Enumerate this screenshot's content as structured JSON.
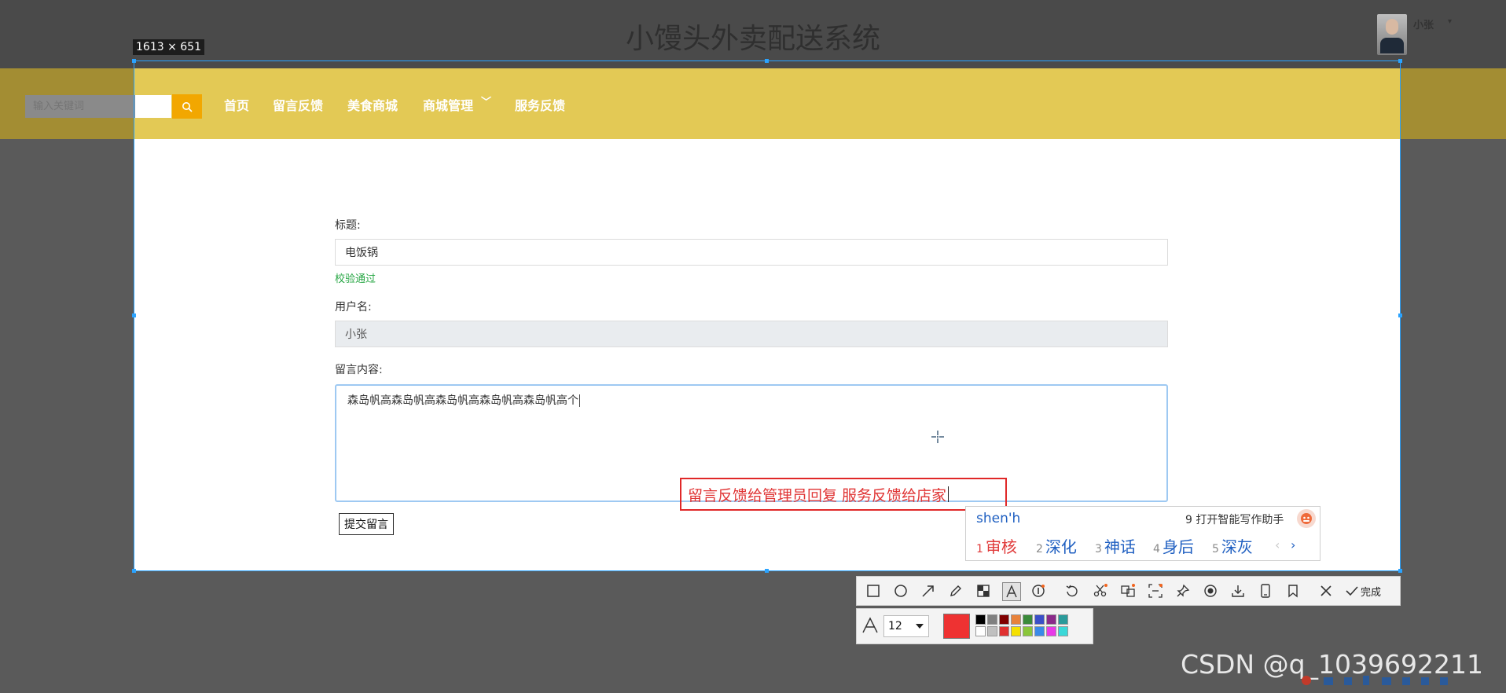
{
  "header": {
    "site_title": "小馒头外卖配送系统",
    "user_name": "小张",
    "user_caret": "▾"
  },
  "search": {
    "placeholder": "输入关键词"
  },
  "nav": {
    "items": [
      "首页",
      "留言反馈",
      "美食商城",
      "商城管理",
      "服务反馈"
    ],
    "dropdown_caret": "﹀"
  },
  "capture": {
    "size_label": "1613 × 651",
    "border_color": "#2aa3ff"
  },
  "form": {
    "title_label": "标题:",
    "title_value": "电饭锅",
    "title_validation": "校验通过",
    "username_label": "用户名:",
    "username_value": "小张",
    "content_label": "留言内容:",
    "content_value": "森岛帆高森岛帆高森岛帆高森岛帆高森岛帆高个",
    "submit_label": "提交留言"
  },
  "annotation": {
    "text": "留言反馈给管理员回复  服务反馈给店家",
    "color": "#e02828"
  },
  "ime": {
    "input": "shen'h",
    "assist_label": "9 打开智能写作助手",
    "candidates": [
      {
        "num": "1",
        "text": "审核"
      },
      {
        "num": "2",
        "text": "深化"
      },
      {
        "num": "3",
        "text": "神话"
      },
      {
        "num": "4",
        "text": "身后"
      },
      {
        "num": "5",
        "text": "深灰"
      }
    ],
    "prev": "‹",
    "next": "›"
  },
  "toolbar": {
    "tools": [
      "rectangle-tool",
      "ellipse-tool",
      "arrow-tool",
      "pen-tool",
      "mosaic-tool",
      "text-tool",
      "number-tool",
      "undo-tool",
      "pin-tool",
      "translate-tool",
      "scan-tool",
      "sticker-tool",
      "record-tool",
      "save-tool",
      "long-screenshot-tool",
      "bookmark-tool",
      "close-tool",
      "done-tool"
    ],
    "done_label": "完成"
  },
  "style_bar": {
    "font_size": "12",
    "current_color": "#ee3232",
    "swatches_top": [
      "#000000",
      "#808080",
      "#800000",
      "#e8823a",
      "#3a8a3a",
      "#3a4fc8",
      "#8a2a8a",
      "#2a9a9a"
    ],
    "swatches_bottom": [
      "#ffffff",
      "#c0c0c0",
      "#e03030",
      "#f5e000",
      "#8ac63a",
      "#3a8ae8",
      "#e83ae8",
      "#3ad8d8"
    ]
  },
  "watermark": "CSDN @q_1039692211"
}
